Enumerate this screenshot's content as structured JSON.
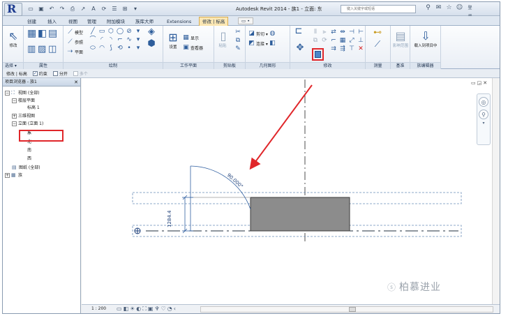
{
  "titlebar": {
    "app_title": "Autodesk Revit 2014 -",
    "doc_title": "族1 - 立面: 东",
    "search_placeholder": "键入关键字或短语",
    "login_label": "登录",
    "qat_icons": [
      "open-icon",
      "save-icon",
      "undo-icon",
      "redo-icon",
      "print-icon",
      "measure-icon",
      "text-icon",
      "sync-icon"
    ]
  },
  "tabs": [
    {
      "label": "创建"
    },
    {
      "label": "插入"
    },
    {
      "label": "视图"
    },
    {
      "label": "管理"
    },
    {
      "label": "附加模块"
    },
    {
      "label": "族库大师"
    },
    {
      "label": "Extensions"
    },
    {
      "label": "修改 | 标高"
    },
    {
      "label": "▭ •"
    }
  ],
  "ribbon": {
    "select_panel": {
      "tool_label": "修改",
      "label": "选择 ▾"
    },
    "properties_panel": {
      "label": "属性"
    },
    "draw_panel": {
      "label": "绘制",
      "tools": [
        "模型",
        "参照",
        "平面"
      ]
    },
    "workplane_panel": {
      "label": "工作平面",
      "set_label": "设置",
      "show_label": "显示",
      "viewer_label": "查看器"
    },
    "clipboard_panel": {
      "label": "剪贴板",
      "paste_label": "粘贴"
    },
    "geometry_panel": {
      "label": "几何图形",
      "cut_label": "剪切 ▾",
      "join_label": "连接 ▾"
    },
    "modify_panel": {
      "label": "修改"
    },
    "measure_panel": {
      "label": "测量"
    },
    "create_panel": {
      "label": "基准",
      "tool_label": "影响范围"
    },
    "family_editor_panel": {
      "label": "族编辑器",
      "tool_label": "载入到项目中"
    }
  },
  "optbar": {
    "context_label": "修改 | 标高",
    "constrain_label": "约束",
    "split_label": "分开",
    "multiple_label": "多个"
  },
  "browser": {
    "title": "项目浏览器 - 族1",
    "items": [
      {
        "label": "视图 (全部)"
      },
      {
        "label": "楼层平面"
      },
      {
        "label": "标高 1"
      },
      {
        "label": "三维视图"
      },
      {
        "label": "立面 (立面 1)"
      },
      {
        "label": "东"
      },
      {
        "label": "北"
      },
      {
        "label": "南"
      },
      {
        "label": "西"
      },
      {
        "label": "图纸 (全部)"
      },
      {
        "label": "族"
      }
    ]
  },
  "canvas": {
    "angle_label": "90.000°",
    "dimension_label": "1284.4",
    "watermark": "柏慕进业",
    "accent_red": "#e0262a"
  },
  "statusbar": {
    "scale": "1 : 200"
  }
}
